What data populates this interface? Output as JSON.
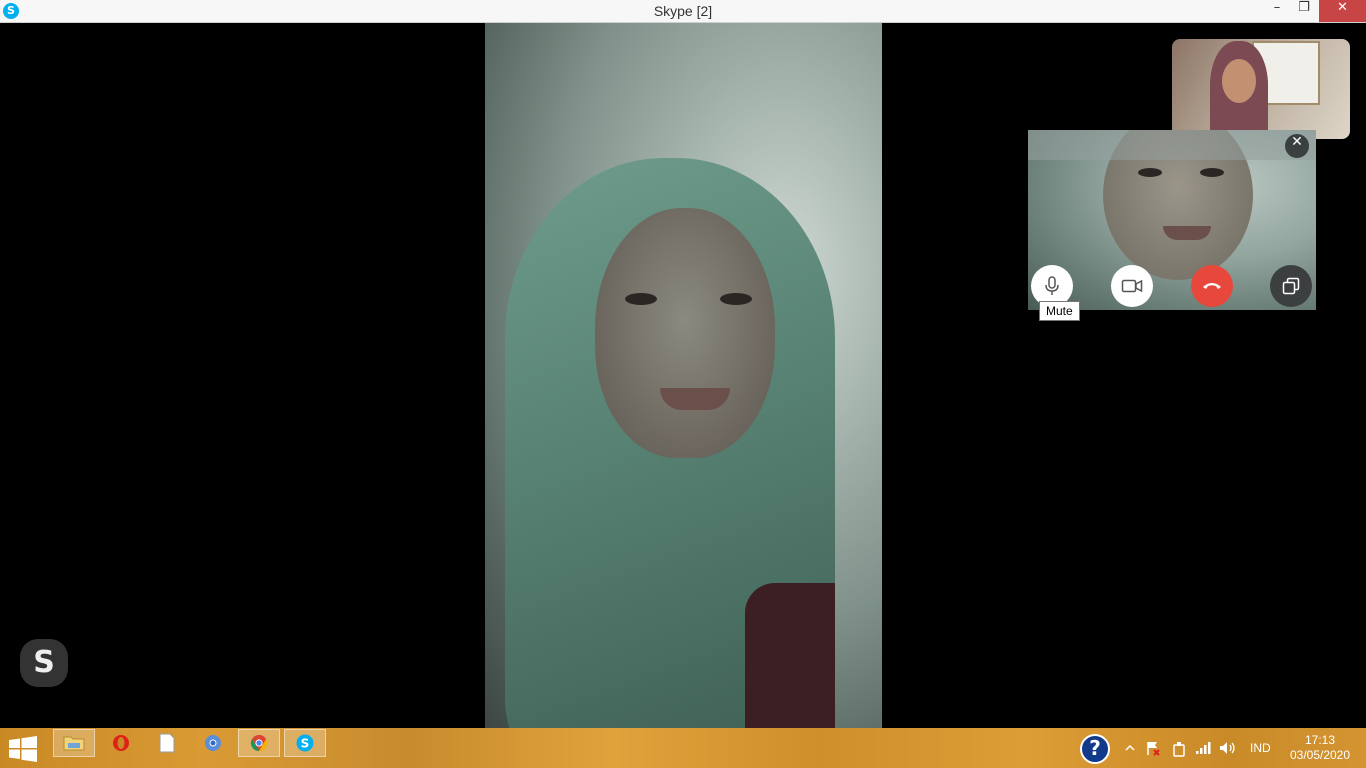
{
  "window": {
    "title": "Skype [2]",
    "icon": "skype-icon",
    "buttons": {
      "minimize": "–",
      "maximize": "❐",
      "close": "✕"
    }
  },
  "call": {
    "controls": {
      "close": "✕",
      "mute_tooltip": "Mute",
      "mic_icon": "microphone-icon",
      "video_icon": "video-camera-icon",
      "hangup_icon": "end-call-icon",
      "restore_icon": "restore-window-icon",
      "hangup_color": "#e8473b"
    },
    "watermark": "S"
  },
  "taskbar": {
    "apps": [
      {
        "name": "file-explorer",
        "icon": "folder-icon",
        "active": true
      },
      {
        "name": "opera",
        "icon": "opera-icon",
        "active": false
      },
      {
        "name": "notepad",
        "icon": "document-icon",
        "active": false
      },
      {
        "name": "chromium",
        "icon": "chromium-icon",
        "active": false
      },
      {
        "name": "chrome",
        "icon": "chrome-icon",
        "active": true
      },
      {
        "name": "skype",
        "icon": "skype-icon",
        "active": true
      }
    ],
    "help": "?",
    "language": "IND",
    "time": "17:13",
    "date": "03/05/2020"
  }
}
